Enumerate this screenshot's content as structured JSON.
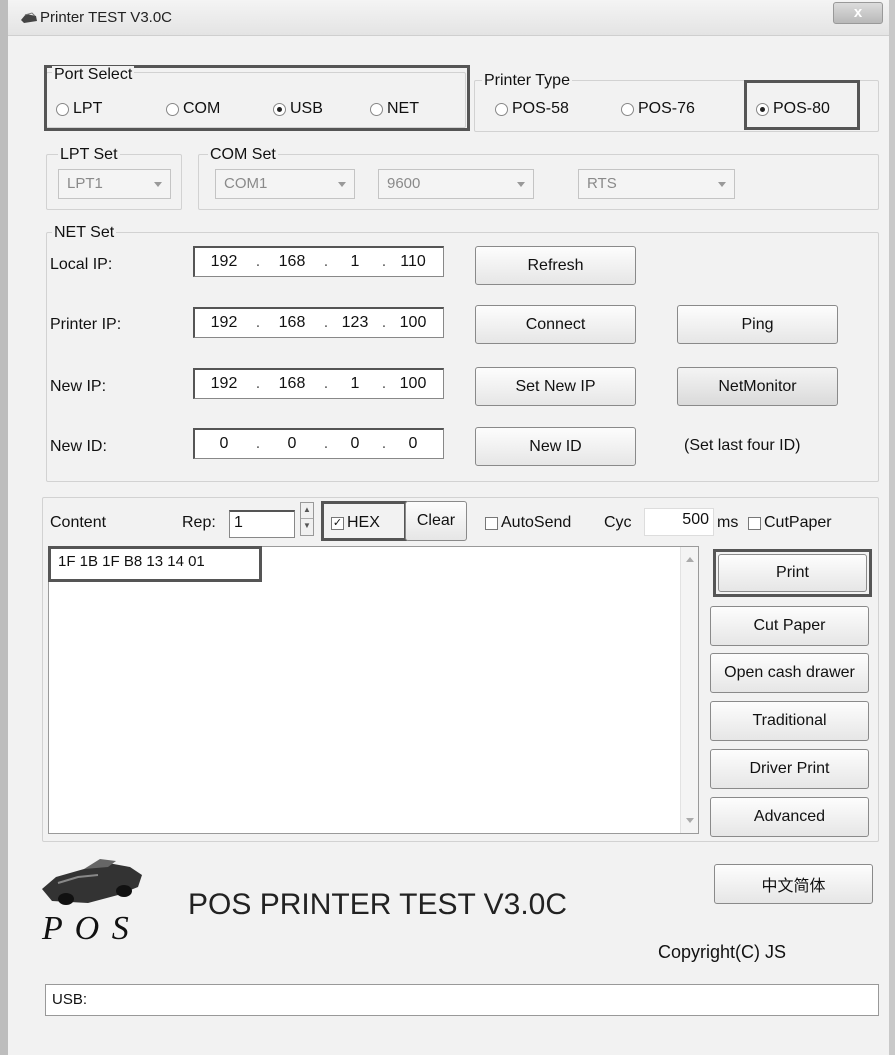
{
  "window": {
    "title": "Printer TEST V3.0C",
    "close_label": "x"
  },
  "port_select": {
    "label": "Port Select",
    "options": [
      {
        "label": "LPT",
        "selected": false
      },
      {
        "label": "COM",
        "selected": false
      },
      {
        "label": "USB",
        "selected": true
      },
      {
        "label": "NET",
        "selected": false
      }
    ]
  },
  "printer_type": {
    "label": "Printer Type",
    "options": [
      {
        "label": "POS-58",
        "selected": false
      },
      {
        "label": "POS-76",
        "selected": false
      },
      {
        "label": "POS-80",
        "selected": true
      }
    ]
  },
  "lpt_set": {
    "label": "LPT Set",
    "port": "LPT1"
  },
  "com_set": {
    "label": "COM Set",
    "port": "COM1",
    "baud": "9600",
    "flow": "RTS"
  },
  "net_set": {
    "label": "NET Set",
    "local_ip": {
      "label": "Local IP:",
      "octets": [
        "192",
        "168",
        "1",
        "110"
      ]
    },
    "printer_ip": {
      "label": "Printer IP:",
      "octets": [
        "192",
        "168",
        "123",
        "100"
      ]
    },
    "new_ip": {
      "label": "New IP:",
      "octets": [
        "192",
        "168",
        "1",
        "100"
      ]
    },
    "new_id": {
      "label": "New ID:",
      "octets": [
        "0",
        "0",
        "0",
        "0"
      ]
    },
    "refresh_label": "Refresh",
    "connect_label": "Connect",
    "ping_label": "Ping",
    "set_new_ip_label": "Set New IP",
    "netmonitor_label": "NetMonitor",
    "new_id_button_label": "New ID",
    "id_hint": "(Set last four ID)"
  },
  "content": {
    "label": "Content",
    "rep_label": "Rep:",
    "rep_value": "1",
    "hex_label": "HEX",
    "hex_checked": true,
    "clear_label": "Clear",
    "autosend_label": "AutoSend",
    "autosend_checked": false,
    "cyc_label": "Cyc",
    "cyc_value": "500",
    "ms_label": "ms",
    "cutpaper_label": "CutPaper",
    "cutpaper_checked": false,
    "text": "1F 1B 1F B8 13 14 01"
  },
  "actions": {
    "print": "Print",
    "cut_paper": "Cut Paper",
    "open_cash_drawer": "Open cash drawer",
    "traditional": "Traditional",
    "driver_print": "Driver Print",
    "advanced": "Advanced",
    "language": "中文简体"
  },
  "branding": {
    "logo_text": "P O S",
    "app_title": "POS PRINTER TEST V3.0C",
    "copyright": "Copyright(C) JS"
  },
  "status": {
    "text": "USB:"
  }
}
